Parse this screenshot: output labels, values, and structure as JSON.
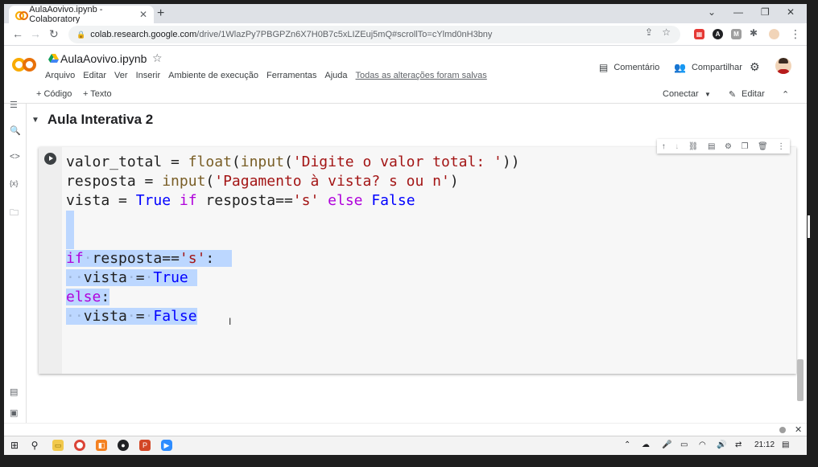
{
  "browser": {
    "tab_title": "AulaAovivo.ipynb - Colaboratory",
    "tab_close": "✕",
    "new_tab": "+",
    "url_host": "colab.research.google.com",
    "url_path": "/drive/1WlazPy7PBGPZn6X7H0B7c5xLIZEuj5mQ#scrollTo=cYlmd0nH3bny"
  },
  "colab": {
    "notebook_title": "AulaAovivo.ipynb",
    "menu": [
      "Arquivo",
      "Editar",
      "Ver",
      "Inserir",
      "Ambiente de execução",
      "Ferramentas",
      "Ajuda"
    ],
    "saved_status": "Todas as alterações foram salvas",
    "comment_label": "Comentário",
    "share_label": "Compartilhar",
    "add_code": "+ Código",
    "add_text": "+ Texto",
    "connect_label": "Conectar",
    "edit_label": "Editar"
  },
  "section": {
    "title": "Aula Interativa 2"
  },
  "code": {
    "line1": {
      "a": "valor_total = ",
      "b": "float",
      "c": "(",
      "d": "input",
      "e": "(",
      "f": "'Digite o valor total: '",
      "g": "))"
    },
    "line2": {
      "a": "resposta = ",
      "b": "input",
      "c": "(",
      "d": "'Pagamento à vista? s ou n'",
      "e": ")"
    },
    "line3": {
      "a": "vista = ",
      "b": "True",
      "c": " if ",
      "d": "resposta==",
      "e": "'s'",
      "f": " else ",
      "g": "False"
    },
    "line6": {
      "a": "if",
      "b": "·",
      "c": "resposta==",
      "d": "'s'",
      "e": ":"
    },
    "line7": {
      "a": "··",
      "b": "vista",
      "c": "·",
      "d": "=",
      "e": "·",
      "f": "True"
    },
    "line8": {
      "a": "else",
      "b": ":"
    },
    "line9": {
      "a": "··",
      "b": "vista",
      "c": "·",
      "d": "=",
      "e": "·",
      "f": "False"
    }
  },
  "taskbar": {
    "time": "21:12"
  },
  "colors": {
    "keyword": "#af00db",
    "builtin": "#0000ff",
    "function": "#795e26",
    "string": "#a31515",
    "selection": "#bcd7ff",
    "colab_orange": "#f9ab00"
  }
}
